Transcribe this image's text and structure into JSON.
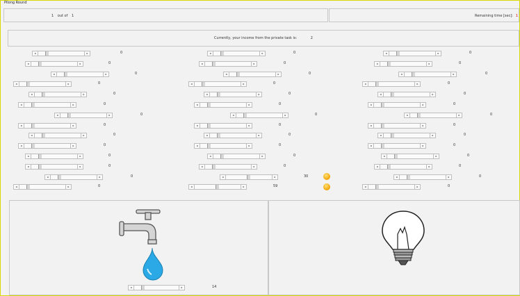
{
  "window": {
    "title": "Pilong Round"
  },
  "round": {
    "current": "1",
    "of": "out of",
    "total": "1"
  },
  "timer": {
    "label": "Remaining time [sec]:",
    "value": "1"
  },
  "income": {
    "label": "Currently, your income from the private task is:",
    "value": "2"
  },
  "columns": [
    {
      "rows": [
        {
          "value": "0"
        },
        {
          "value": "0"
        },
        {
          "value": "0"
        },
        {
          "value": "0"
        },
        {
          "value": "0"
        },
        {
          "value": "0"
        },
        {
          "value": "0"
        },
        {
          "value": "0"
        },
        {
          "value": "0"
        },
        {
          "value": "0"
        },
        {
          "value": "0"
        },
        {
          "value": "0"
        },
        {
          "value": "0"
        },
        {
          "value": "0"
        }
      ]
    },
    {
      "rows": [
        {
          "value": "0"
        },
        {
          "value": "0"
        },
        {
          "value": "0"
        },
        {
          "value": "0"
        },
        {
          "value": "0"
        },
        {
          "value": "0"
        },
        {
          "value": "0"
        },
        {
          "value": "0"
        },
        {
          "value": "0"
        },
        {
          "value": "0"
        },
        {
          "value": "0"
        },
        {
          "value": "0"
        },
        {
          "value": "30"
        },
        {
          "value": "59"
        }
      ]
    },
    {
      "rows": [
        {
          "value": "0"
        },
        {
          "value": "0"
        },
        {
          "value": "0"
        },
        {
          "value": "0"
        },
        {
          "value": "0"
        },
        {
          "value": "0"
        },
        {
          "value": "0"
        },
        {
          "value": "0"
        },
        {
          "value": "0"
        },
        {
          "value": "0"
        },
        {
          "value": "0"
        },
        {
          "value": "0"
        },
        {
          "value": "0"
        },
        {
          "value": "0"
        }
      ]
    }
  ],
  "tap_slider": {
    "value": "14"
  },
  "colors": {
    "border": "#d8d800",
    "timer": "#cc0000",
    "water": "#2aa9e6",
    "coin": "#f2a300"
  },
  "icons": {
    "tap": "water-tap-icon",
    "drop": "water-drop-icon",
    "bulb": "light-bulb-icon",
    "coin": "coin-icon"
  }
}
